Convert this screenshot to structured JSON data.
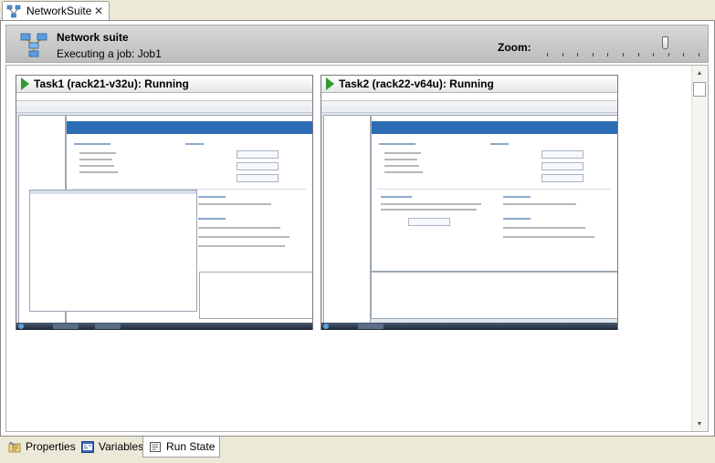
{
  "tab": {
    "title": "NetworkSuite",
    "close": "✕",
    "icon": "network-icon"
  },
  "header": {
    "title": "Network suite",
    "subtitle": "Executing a job: Job1",
    "zoom_label": "Zoom:",
    "zoom_level": 0.78,
    "zoom_ticks": 11
  },
  "tasks": [
    {
      "title": "Task1 (rack21-v32u): Running",
      "status_color": "#2f9a2f"
    },
    {
      "title": "Task2 (rack22-v64u): Running",
      "status_color": "#2f9a2f"
    }
  ],
  "scrollbar": {
    "up": "▲",
    "down": "▼"
  },
  "bottom_tabs": [
    {
      "label": "Properties",
      "icon": "properties-icon",
      "active": false
    },
    {
      "label": "Variables",
      "icon": "variables-icon",
      "active": false
    },
    {
      "label": "Run State",
      "icon": "run-state-icon",
      "active": true
    }
  ]
}
